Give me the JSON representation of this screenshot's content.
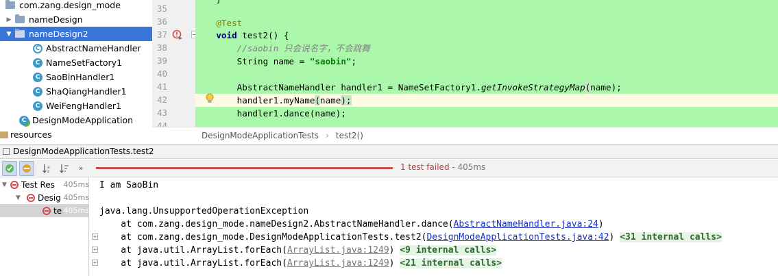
{
  "project_tree": {
    "package": "com.zang.design_mode",
    "items": [
      {
        "label": "nameDesign"
      },
      {
        "label": "nameDesign2"
      },
      {
        "label": "AbstractNameHandler"
      },
      {
        "label": "NameSetFactory1"
      },
      {
        "label": "SaoBinHandler1"
      },
      {
        "label": "ShaQiangHandler1"
      },
      {
        "label": "WeiFengHandler1"
      },
      {
        "label": "DesignModeApplication"
      }
    ],
    "resources": "resources"
  },
  "editor": {
    "line_numbers": [
      "35",
      "36",
      "37",
      "38",
      "39",
      "40",
      "41",
      "42",
      "43",
      "44"
    ],
    "annotation": "@Test",
    "kw_void": "void",
    "method_sig": " test2() {",
    "comment": "//saobin 只会说名字，不会跳舞",
    "string_decl": "String name = ",
    "string_value": "\"saobin\"",
    "semicolon": ";",
    "handler_decl": "AbstractNameHandler handler1 = NameSetFactory1.",
    "factory_method": "getInvokeStrategyMap",
    "paren_open": "(",
    "arg_name": "name",
    "paren_close_semi": ");",
    "call_myname": "handler1.myName",
    "call_dance": "handler1.dance"
  },
  "breadcrumb": {
    "class_name": "DesignModeApplicationTests",
    "method_name": "test2()"
  },
  "run_window": {
    "title": "DesignModeApplicationTests.test2",
    "status_text": "1 test failed",
    "status_time": " - 405ms",
    "status_color": "#c04040"
  },
  "results_tree": {
    "rows": [
      {
        "label": "Test Res",
        "time": "405ms"
      },
      {
        "label": "Desig",
        "time": "405ms"
      },
      {
        "label": "te",
        "time": "405ms"
      }
    ]
  },
  "console": {
    "output": "I am SaoBin",
    "exception": "java.lang.UnsupportedOperationException",
    "frames": [
      {
        "prefix": "    at com.zang.design_mode.nameDesign2.AbstractNameHandler.dance(",
        "link": "AbstractNameHandler.java:24",
        "suffix": ")",
        "extra": ""
      },
      {
        "prefix": "    at com.zang.design_mode.DesignModeApplicationTests.test2(",
        "link": "DesignModeApplicationTests.java:42",
        "suffix": ") ",
        "extra": "<31 internal calls>"
      },
      {
        "prefix": "    at java.util.ArrayList.forEach(",
        "link": "ArrayList.java:1249",
        "suffix": ") ",
        "extra": "<9 internal calls>"
      },
      {
        "prefix": "    at java.util.ArrayList.forEach(",
        "link": "ArrayList.java:1249",
        "suffix": ") ",
        "extra": "<21 internal calls>"
      }
    ]
  },
  "colors": {
    "editor_bg": "#abf7ab",
    "selection": "#3875d7",
    "fail_red": "#d64b4b"
  }
}
